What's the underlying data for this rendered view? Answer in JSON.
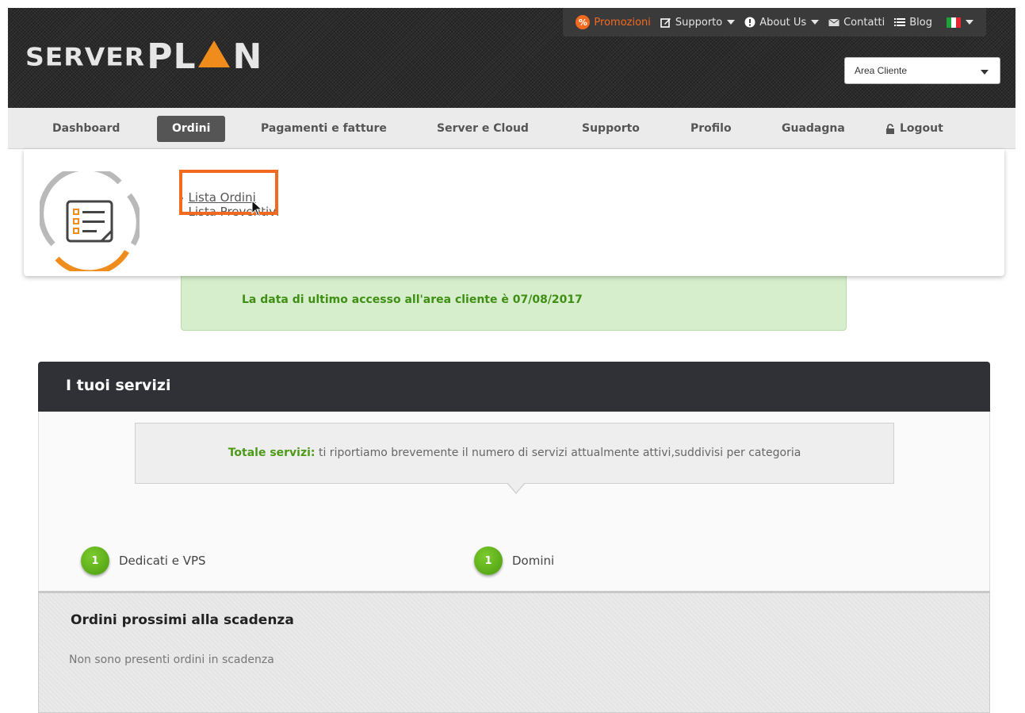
{
  "header": {
    "logo_part1": "SERVER",
    "logo_part2": "PL",
    "logo_part3": "N",
    "topnav": {
      "promo_badge": "%",
      "promo_label": "Promozioni",
      "support_label": "Supporto",
      "about_label": "About Us",
      "contact_label": "Contatti",
      "blog_label": "Blog"
    },
    "area_select_value": "Area Cliente"
  },
  "mainnav": {
    "items": [
      {
        "label": "Dashboard"
      },
      {
        "label": "Ordini"
      },
      {
        "label": "Pagamenti e fatture"
      },
      {
        "label": "Server e Cloud"
      },
      {
        "label": "Supporto"
      },
      {
        "label": "Profilo"
      },
      {
        "label": "Guadagna"
      },
      {
        "label": "Logout"
      }
    ],
    "active": "Ordini"
  },
  "dropdown": {
    "links": [
      {
        "label": "Lista Ordini"
      },
      {
        "label": "Lista Preventivi"
      }
    ]
  },
  "alert": {
    "text": "La data di ultimo accesso all'area cliente è 07/08/2017"
  },
  "services": {
    "title": "I tuoi servizi",
    "info_bold": "Totale servizi:",
    "info_text": " ti riportiamo brevemente il numero di servizi attualmente attivi,suddivisi per categoria",
    "items": [
      {
        "count": "1",
        "label": "Dedicati e VPS"
      },
      {
        "count": "1",
        "label": "Domini"
      }
    ]
  },
  "expiring": {
    "title": "Ordini prossimi alla scadenza",
    "empty_text": "Non sono presenti ordini in scadenza"
  },
  "colors": {
    "accent_orange": "#f26a20",
    "success_green": "#4c9a18",
    "panel_dark": "#2f3137"
  }
}
